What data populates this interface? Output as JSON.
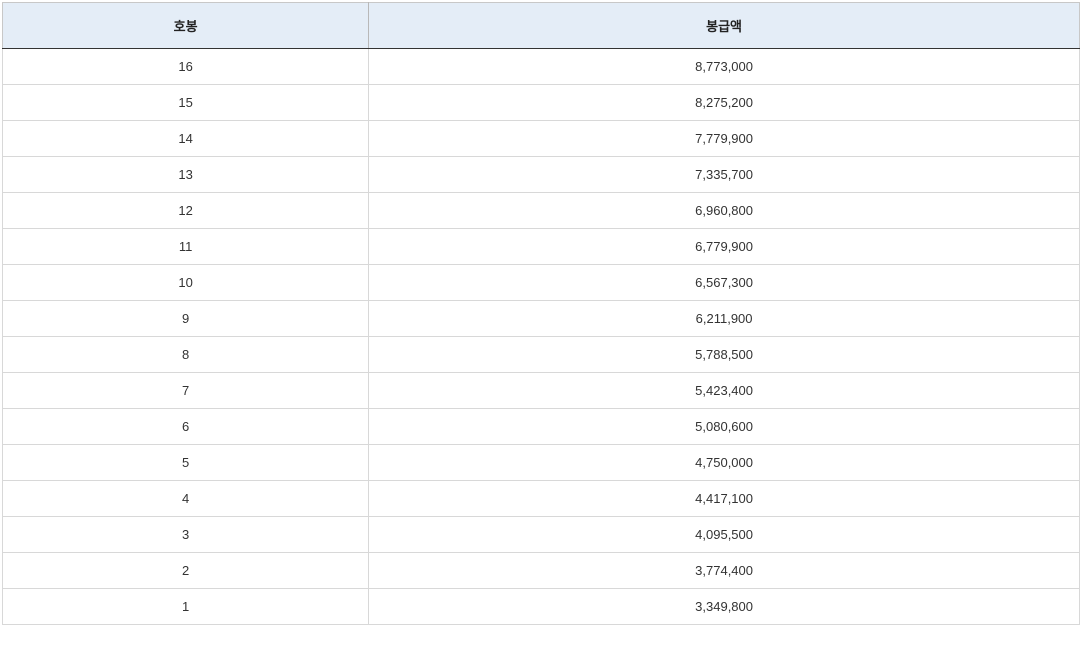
{
  "table": {
    "headers": {
      "col1": "호봉",
      "col2": "봉급액"
    },
    "rows": [
      {
        "grade": "16",
        "amount": "8,773,000"
      },
      {
        "grade": "15",
        "amount": "8,275,200"
      },
      {
        "grade": "14",
        "amount": "7,779,900"
      },
      {
        "grade": "13",
        "amount": "7,335,700"
      },
      {
        "grade": "12",
        "amount": "6,960,800"
      },
      {
        "grade": "11",
        "amount": "6,779,900"
      },
      {
        "grade": "10",
        "amount": "6,567,300"
      },
      {
        "grade": "9",
        "amount": "6,211,900"
      },
      {
        "grade": "8",
        "amount": "5,788,500"
      },
      {
        "grade": "7",
        "amount": "5,423,400"
      },
      {
        "grade": "6",
        "amount": "5,080,600"
      },
      {
        "grade": "5",
        "amount": "4,750,000"
      },
      {
        "grade": "4",
        "amount": "4,417,100"
      },
      {
        "grade": "3",
        "amount": "4,095,500"
      },
      {
        "grade": "2",
        "amount": "3,774,400"
      },
      {
        "grade": "1",
        "amount": "3,349,800"
      }
    ]
  }
}
